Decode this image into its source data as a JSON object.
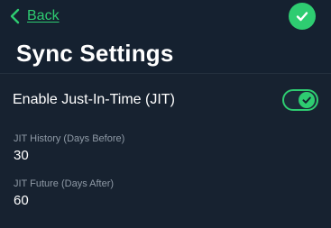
{
  "header": {
    "back_label": "Back",
    "title": "Sync Settings"
  },
  "settings": {
    "jit": {
      "label": "Enable Just-In-Time (JIT)",
      "enabled": true
    },
    "history": {
      "label": "JIT History (Days Before)",
      "value": "30"
    },
    "future": {
      "label": "JIT Future (Days After)",
      "value": "60"
    }
  },
  "colors": {
    "accent": "#2ecc71",
    "background": "#172230",
    "muted_text": "#8f9aa6"
  },
  "icons": {
    "back": "chevron-left-icon",
    "confirm": "checkmark-icon",
    "toggle_on": "checkmark-icon"
  }
}
